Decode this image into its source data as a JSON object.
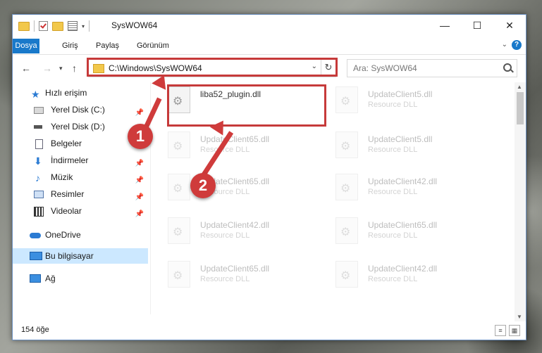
{
  "window": {
    "title": "SysWOW64"
  },
  "ribbon": {
    "tabs": [
      "Dosya",
      "Giriş",
      "Paylaş",
      "Görünüm"
    ]
  },
  "address": {
    "path": "C:\\Windows\\SysWOW64",
    "search_placeholder": "Ara: SysWOW64"
  },
  "nav": {
    "items": [
      {
        "label": "Hızlı erişim"
      },
      {
        "label": "Yerel Disk (C:)"
      },
      {
        "label": "Yerel Disk (D:)"
      },
      {
        "label": "Belgeler"
      },
      {
        "label": "İndirmeler"
      },
      {
        "label": "Müzik"
      },
      {
        "label": "Resimler"
      },
      {
        "label": "Videolar"
      },
      {
        "label": "OneDrive"
      },
      {
        "label": "Bu bilgisayar"
      },
      {
        "label": "Ağ"
      }
    ]
  },
  "files": [
    {
      "name": "liba52_plugin.dll",
      "type": ""
    },
    {
      "name": "UpdateClient5.dll",
      "type": "Resource DLL"
    },
    {
      "name": "UpdateClient65.dll",
      "type": "Resource DLL"
    },
    {
      "name": "UpdateClient5.dll",
      "type": "Resource DLL"
    },
    {
      "name": "UpdateClient65.dll",
      "type": "Resource DLL"
    },
    {
      "name": "UpdateClient42.dll",
      "type": "Resource DLL"
    },
    {
      "name": "UpdateClient42.dll",
      "type": "Resource DLL"
    },
    {
      "name": "UpdateClient65.dll",
      "type": "Resource DLL"
    },
    {
      "name": "UpdateClient65.dll",
      "type": "Resource DLL"
    },
    {
      "name": "UpdateClient42.dll",
      "type": "Resource DLL"
    }
  ],
  "status": {
    "count": "154 öğe"
  },
  "annotations": {
    "step1": "1",
    "step2": "2"
  },
  "colors": {
    "accent": "#1979ca",
    "highlight": "#c63a3a",
    "selection": "#cce8ff"
  }
}
